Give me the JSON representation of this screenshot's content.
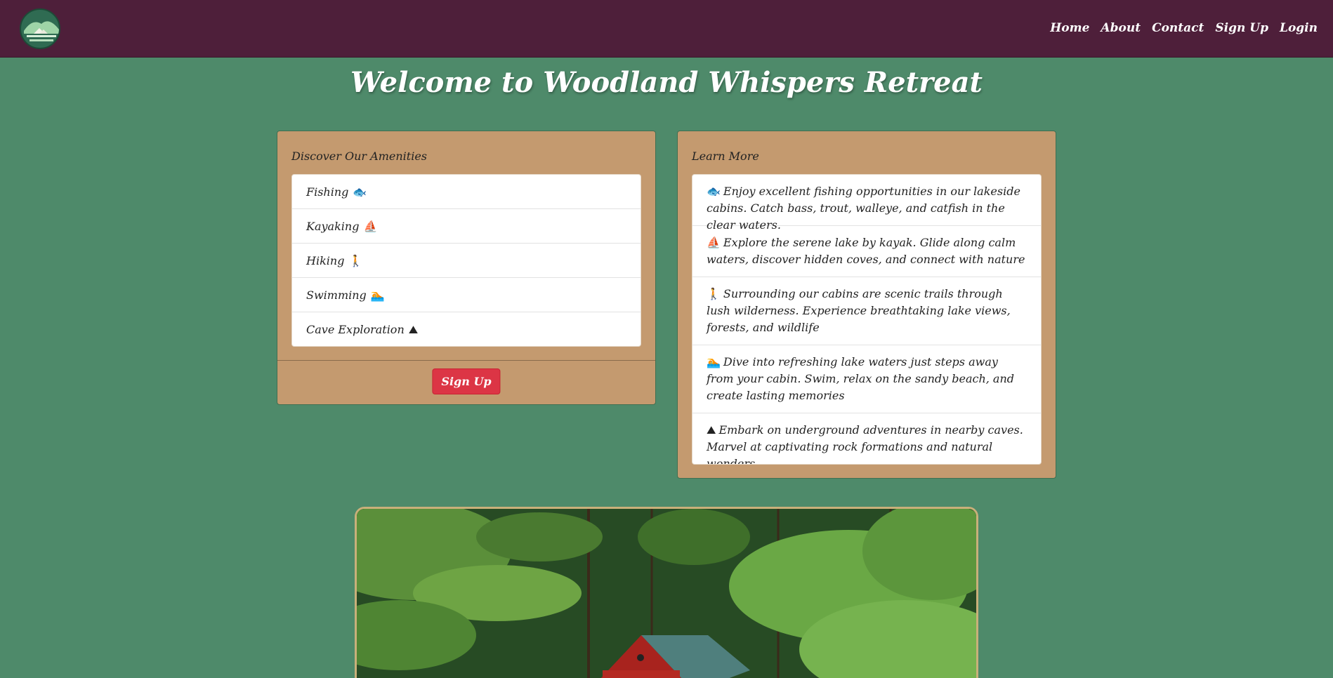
{
  "nav": {
    "links": [
      "Home",
      "About",
      "Contact",
      "Sign Up",
      "Login"
    ]
  },
  "page": {
    "title": "Welcome to Woodland Whispers Retreat"
  },
  "amenities": {
    "header": "Discover Our Amenities",
    "items": [
      {
        "label": "Fishing",
        "icon": "🐟"
      },
      {
        "label": "Kayaking",
        "icon": "⛵"
      },
      {
        "label": "Hiking",
        "icon": "🚶"
      },
      {
        "label": "Swimming",
        "icon": "🏊"
      },
      {
        "label": "Cave Exploration",
        "icon": "⛰"
      }
    ],
    "button": "Sign Up"
  },
  "learn": {
    "header": "Learn More",
    "items": [
      {
        "icon": "🐟",
        "text": "Enjoy excellent fishing opportunities in our lakeside cabins. Catch bass, trout, walleye, and catfish in the clear waters."
      },
      {
        "icon": "⛵",
        "text": "Explore the serene lake by kayak. Glide along calm waters, discover hidden coves, and connect with nature"
      },
      {
        "icon": "🚶",
        "text": "Surrounding our cabins are scenic trails through lush wilderness. Experience breathtaking lake views, forests, and wildlife"
      },
      {
        "icon": "🏊",
        "text": "Dive into refreshing lake waters just steps away from your cabin. Swim, relax on the sandy beach, and create lasting memories"
      },
      {
        "icon": "⛰",
        "text": "Embark on underground adventures in nearby caves. Marvel at captivating rock formations and natural wonders"
      }
    ]
  },
  "colors": {
    "background": "#4e8a6a",
    "navbar": "#4e1f3a",
    "card": "#c49a6f",
    "button": "#dc3545"
  }
}
